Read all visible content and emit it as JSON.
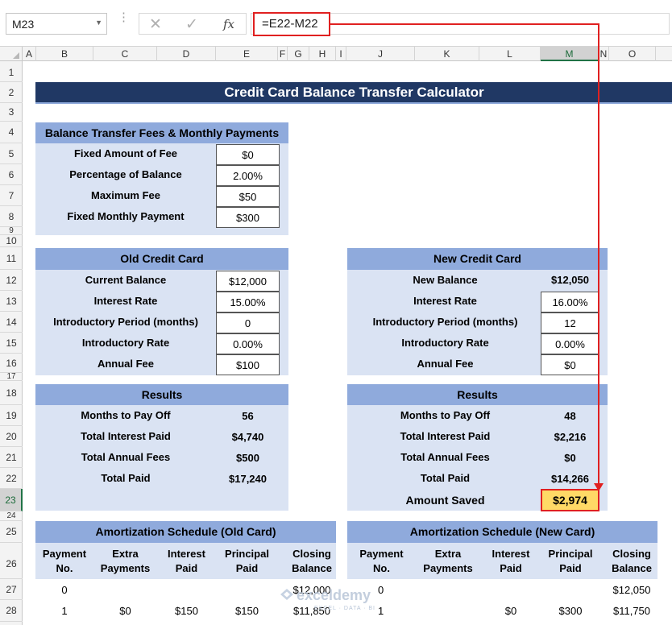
{
  "formula_bar": {
    "name_box": "M23",
    "formula": "=E22-M22"
  },
  "columns": [
    "A",
    "B",
    "C",
    "D",
    "E",
    "F",
    "G",
    "H",
    "I",
    "J",
    "K",
    "L",
    "M",
    "N",
    "O"
  ],
  "rows": [
    "1",
    "2",
    "3",
    "4",
    "5",
    "6",
    "7",
    "8",
    "9",
    "10",
    "11",
    "12",
    "13",
    "14",
    "15",
    "16",
    "17",
    "18",
    "19",
    "20",
    "21",
    "22",
    "23",
    "24",
    "25",
    "26",
    "27",
    "28"
  ],
  "title": "Credit Card Balance Transfer Calculator",
  "fees": {
    "header": "Balance Transfer Fees & Monthly Payments",
    "items": [
      {
        "label": "Fixed Amount of Fee",
        "value": "$0"
      },
      {
        "label": "Percentage of Balance",
        "value": "2.00%"
      },
      {
        "label": "Maximum Fee",
        "value": "$50"
      },
      {
        "label": "Fixed Monthly Payment",
        "value": "$300"
      }
    ]
  },
  "old_card": {
    "header": "Old Credit Card",
    "items": [
      {
        "label": "Current Balance",
        "value": "$12,000"
      },
      {
        "label": "Interest Rate",
        "value": "15.00%"
      },
      {
        "label": "Introductory Period (months)",
        "value": "0"
      },
      {
        "label": "Introductory Rate",
        "value": "0.00%"
      },
      {
        "label": "Annual Fee",
        "value": "$100"
      }
    ]
  },
  "new_card": {
    "header": "New Credit Card",
    "items": [
      {
        "label": "New Balance",
        "value": "$12,050"
      },
      {
        "label": "Interest Rate",
        "value": "16.00%"
      },
      {
        "label": "Introductory Period (months)",
        "value": "12"
      },
      {
        "label": "Introductory Rate",
        "value": "0.00%"
      },
      {
        "label": "Annual Fee",
        "value": "$0"
      }
    ]
  },
  "old_results": {
    "header": "Results",
    "items": [
      {
        "label": "Months to Pay Off",
        "value": "56"
      },
      {
        "label": "Total Interest Paid",
        "value": "$4,740"
      },
      {
        "label": "Total Annual Fees",
        "value": "$500"
      },
      {
        "label": "Total Paid",
        "value": "$17,240"
      }
    ]
  },
  "new_results": {
    "header": "Results",
    "items": [
      {
        "label": "Months to Pay Off",
        "value": "48"
      },
      {
        "label": "Total Interest Paid",
        "value": "$2,216"
      },
      {
        "label": "Total Annual Fees",
        "value": "$0"
      },
      {
        "label": "Total Paid",
        "value": "$14,266"
      }
    ],
    "saved_label": "Amount Saved",
    "saved_value": "$2,974"
  },
  "amort_old": {
    "header": "Amortization Schedule (Old Card)",
    "columns": [
      [
        "Payment",
        "No."
      ],
      [
        "Extra",
        "Payments"
      ],
      [
        "Interest",
        "Paid"
      ],
      [
        "Principal",
        "Paid"
      ],
      [
        "Closing",
        "Balance"
      ]
    ],
    "rows": [
      [
        "0",
        "",
        "",
        "",
        "$12,000"
      ],
      [
        "1",
        "$0",
        "$150",
        "$150",
        "$11,850"
      ]
    ]
  },
  "amort_new": {
    "header": "Amortization Schedule (New Card)",
    "columns": [
      [
        "Payment",
        "No."
      ],
      [
        "Extra",
        "Payments"
      ],
      [
        "Interest",
        "Paid"
      ],
      [
        "Principal",
        "Paid"
      ],
      [
        "Closing",
        "Balance"
      ]
    ],
    "rows": [
      [
        "0",
        "",
        "",
        "",
        "$12,050"
      ],
      [
        "1",
        "",
        "$0",
        "$300",
        "$11,750"
      ]
    ]
  },
  "watermark": {
    "name": "exceldemy",
    "tagline": "EXCEL · DATA · BI"
  },
  "colors": {
    "title_bg": "#203864",
    "panel_bg": "#dae3f3",
    "header_bg": "#8faadc",
    "highlight": "#ffd966",
    "arrow": "#e02020"
  }
}
